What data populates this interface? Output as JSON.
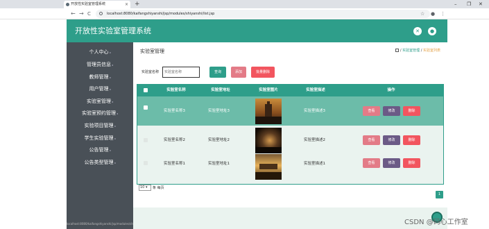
{
  "browser": {
    "tab_title": "开放性实验室管理系统",
    "tab_close": "×",
    "new_tab": "+",
    "back": "←",
    "forward": "→",
    "reload": "C",
    "url": "localhost:8080/kaifangshiyanshi/jsp/modules/shiyanshi/list.jsp",
    "minimize": "–",
    "restore": "❐",
    "close": "✕",
    "star": "☆",
    "profile": "●",
    "menu": "⋮"
  },
  "header": {
    "title": "开放性实验室管理系统",
    "btn1_icon": "✕",
    "btn2_icon": "●"
  },
  "sidebar": {
    "items": [
      {
        "label": "个人中心"
      },
      {
        "label": "管理员信息"
      },
      {
        "label": "教师管理"
      },
      {
        "label": "用户管理"
      },
      {
        "label": "实验室管理"
      },
      {
        "label": "实验室预约管理"
      },
      {
        "label": "实验项目管理"
      },
      {
        "label": "学生实验管理"
      },
      {
        "label": "公告管理"
      },
      {
        "label": "公告类型管理"
      }
    ],
    "arrow": "◂",
    "status_url": "localhost:8080/kaifangshiyanshi/jsp/modules/shiyanshi/list.jsp"
  },
  "main": {
    "heading": "实验室管理",
    "breadcrumb": {
      "sep": "/",
      "item1": "实验室管理",
      "item2": "实验室列表"
    }
  },
  "search": {
    "label": "实验室名称",
    "placeholder": "实验室名称",
    "query_label": "查询",
    "add_label": "添加",
    "batch_delete_label": "批量删除"
  },
  "table": {
    "headers": {
      "name": "实验室名称",
      "address": "实验室地址",
      "photo": "实验室图片",
      "desc": "实验室描述",
      "ops": "操作"
    },
    "rows": [
      {
        "name": "实验室名称3",
        "address": "实验室地址3",
        "desc": "实验室描述3",
        "view": "查看",
        "edit": "修改",
        "delete": "删除"
      },
      {
        "name": "实验室名称2",
        "address": "实验室地址2",
        "desc": "实验室描述2",
        "view": "查看",
        "edit": "修改",
        "delete": "删除"
      },
      {
        "name": "实验室名称1",
        "address": "实验室地址1",
        "desc": "实验室描述1",
        "view": "查看",
        "edit": "修改",
        "delete": "删除"
      }
    ]
  },
  "pager": {
    "page_size": "10 ▾",
    "page_size_suffix": "条 每页",
    "current_page": "1"
  },
  "footer": {
    "watermark": "CSDN @码心工作室"
  },
  "colors": {
    "primary": "#2e9e8a",
    "selected_row": "#6cbca9",
    "view": "#e37b87",
    "edit": "#6b5a86",
    "delete": "#f2555f",
    "query": "#2e9e8a",
    "add": "#e37b87",
    "batch_delete": "#f2555f"
  },
  "icons": {
    "home": "home-icon",
    "fullscreen": "fullscreen-icon",
    "user": "user-icon"
  }
}
